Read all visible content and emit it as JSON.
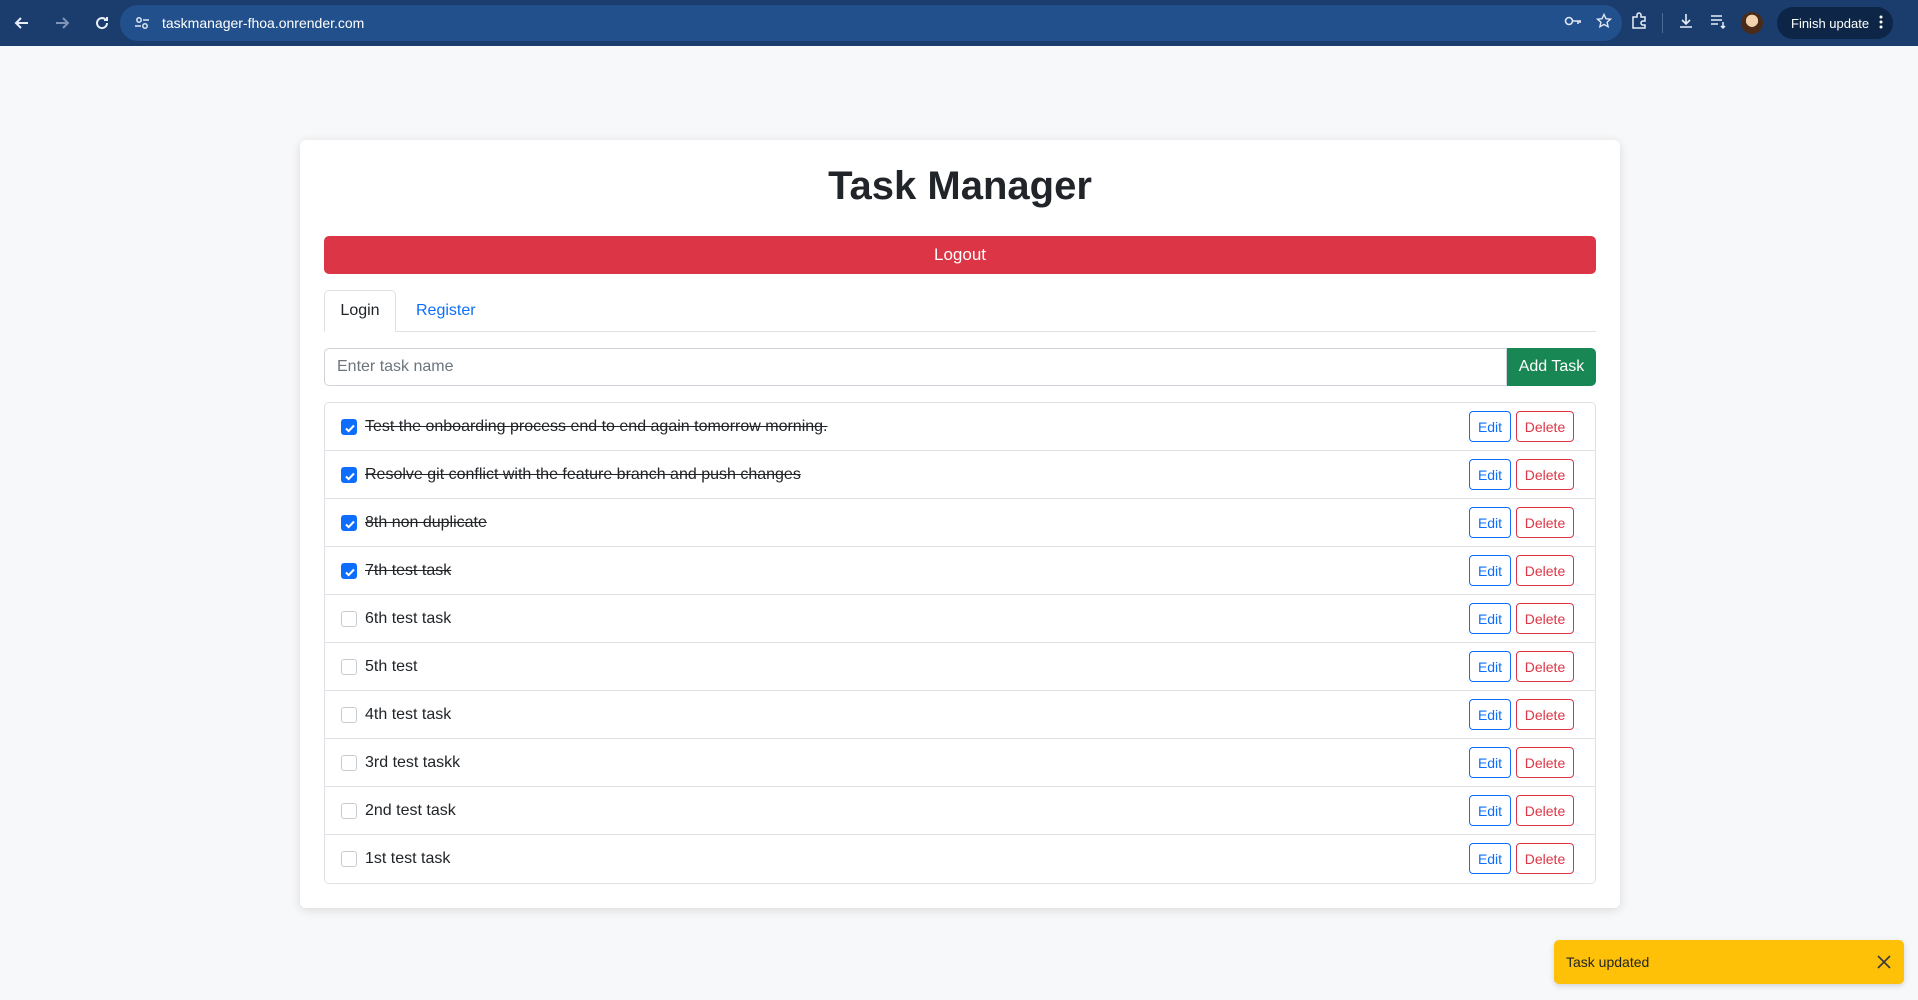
{
  "browser": {
    "url": "taskmanager-fhoa.onrender.com",
    "finish_update_label": "Finish update"
  },
  "app": {
    "title": "Task Manager",
    "logout_label": "Logout",
    "tabs": [
      {
        "label": "Login",
        "active": true
      },
      {
        "label": "Register",
        "active": false
      }
    ],
    "task_input_placeholder": "Enter task name",
    "add_task_label": "Add Task",
    "edit_label": "Edit",
    "delete_label": "Delete",
    "tasks": [
      {
        "text": "Test the onboarding process end to end again tomorrow morning.",
        "completed": true
      },
      {
        "text": "Resolve git conflict with the feature branch and push changes",
        "completed": true
      },
      {
        "text": "8th non duplicate",
        "completed": true
      },
      {
        "text": "7th test task",
        "completed": true
      },
      {
        "text": "6th test task",
        "completed": false
      },
      {
        "text": "5th test",
        "completed": false
      },
      {
        "text": "4th test task",
        "completed": false
      },
      {
        "text": "3rd test taskk",
        "completed": false
      },
      {
        "text": "2nd test task",
        "completed": false
      },
      {
        "text": "1st test task",
        "completed": false
      }
    ]
  },
  "toast": {
    "message": "Task updated"
  },
  "colors": {
    "primary": "#0d6efd",
    "danger": "#dc3545",
    "success": "#198754",
    "warning": "#ffc107",
    "browser_bar": "#1b3d6e"
  }
}
